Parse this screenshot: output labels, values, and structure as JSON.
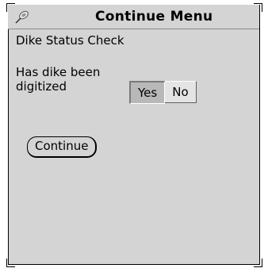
{
  "window": {
    "title": "Continue Menu",
    "title_icon": "pushpin-icon"
  },
  "content": {
    "heading": "Dike Status Check",
    "question": "Has dike been digitized",
    "choices": [
      {
        "label": "Yes",
        "selected": true
      },
      {
        "label": "No",
        "selected": false
      }
    ],
    "continue_label": "Continue"
  }
}
